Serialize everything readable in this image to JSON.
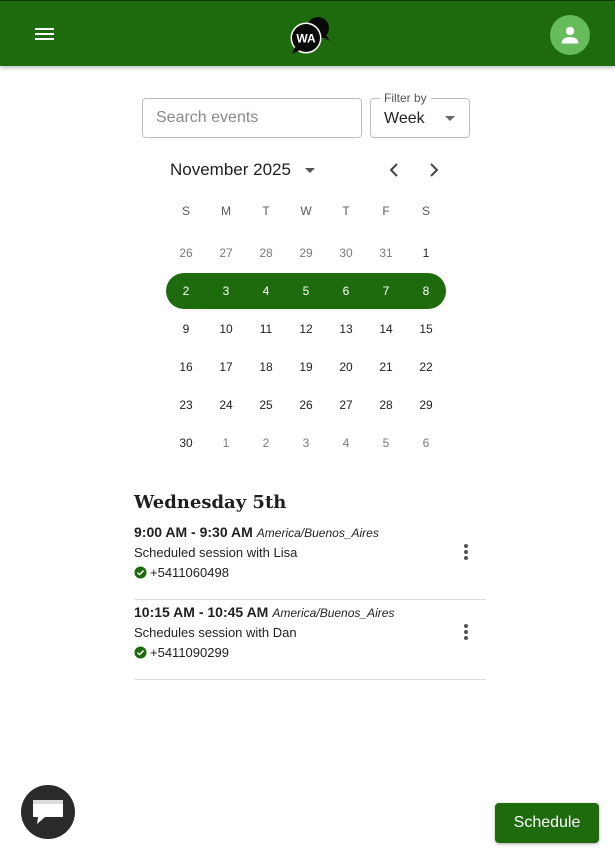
{
  "header": {
    "logo_text": "WA",
    "menu_icon": "hamburger-icon",
    "avatar_icon": "person-icon",
    "color": "#1e6b0e"
  },
  "search": {
    "placeholder": "Search events",
    "value": ""
  },
  "filter": {
    "label": "Filter by",
    "value": "Week"
  },
  "calendar": {
    "month_label": "November 2025",
    "weekdays": [
      "S",
      "M",
      "T",
      "W",
      "T",
      "F",
      "S"
    ],
    "weeks": [
      {
        "selected": false,
        "days": [
          {
            "label": "26",
            "outside": true
          },
          {
            "label": "27",
            "outside": true
          },
          {
            "label": "28",
            "outside": true
          },
          {
            "label": "29",
            "outside": true
          },
          {
            "label": "30",
            "outside": true
          },
          {
            "label": "31",
            "outside": true
          },
          {
            "label": "1",
            "outside": false
          }
        ]
      },
      {
        "selected": true,
        "days": [
          {
            "label": "2",
            "outside": false
          },
          {
            "label": "3",
            "outside": false
          },
          {
            "label": "4",
            "outside": false
          },
          {
            "label": "5",
            "outside": false
          },
          {
            "label": "6",
            "outside": false
          },
          {
            "label": "7",
            "outside": false
          },
          {
            "label": "8",
            "outside": false
          }
        ]
      },
      {
        "selected": false,
        "days": [
          {
            "label": "9",
            "outside": false
          },
          {
            "label": "10",
            "outside": false
          },
          {
            "label": "11",
            "outside": false
          },
          {
            "label": "12",
            "outside": false
          },
          {
            "label": "13",
            "outside": false
          },
          {
            "label": "14",
            "outside": false
          },
          {
            "label": "15",
            "outside": false
          }
        ]
      },
      {
        "selected": false,
        "days": [
          {
            "label": "16",
            "outside": false
          },
          {
            "label": "17",
            "outside": false
          },
          {
            "label": "18",
            "outside": false
          },
          {
            "label": "19",
            "outside": false
          },
          {
            "label": "20",
            "outside": false
          },
          {
            "label": "21",
            "outside": false
          },
          {
            "label": "22",
            "outside": false
          }
        ]
      },
      {
        "selected": false,
        "days": [
          {
            "label": "23",
            "outside": false
          },
          {
            "label": "24",
            "outside": false
          },
          {
            "label": "25",
            "outside": false
          },
          {
            "label": "26",
            "outside": false
          },
          {
            "label": "27",
            "outside": false
          },
          {
            "label": "28",
            "outside": false
          },
          {
            "label": "29",
            "outside": false
          }
        ]
      },
      {
        "selected": false,
        "days": [
          {
            "label": "30",
            "outside": false
          },
          {
            "label": "1",
            "outside": true
          },
          {
            "label": "2",
            "outside": true
          },
          {
            "label": "3",
            "outside": true
          },
          {
            "label": "4",
            "outside": true
          },
          {
            "label": "5",
            "outside": true
          },
          {
            "label": "6",
            "outside": true
          }
        ]
      }
    ]
  },
  "day_heading": "Wednesday 5th",
  "events": [
    {
      "time": "9:00 AM - 9:30 AM",
      "timezone": "America/Buenos_Aires",
      "title": "Scheduled session with Lisa",
      "phone": "+5411060498"
    },
    {
      "time": "10:15 AM - 10:45 AM",
      "timezone": "America/Buenos_Aires",
      "title": "Schedules session with Dan",
      "phone": "+5411090299"
    }
  ],
  "schedule_button": "Schedule",
  "chat_icon": "chat-icon",
  "colors": {
    "accent": "#1e6b0e",
    "avatar": "#66bb5c",
    "check": "#1e6b0e"
  }
}
